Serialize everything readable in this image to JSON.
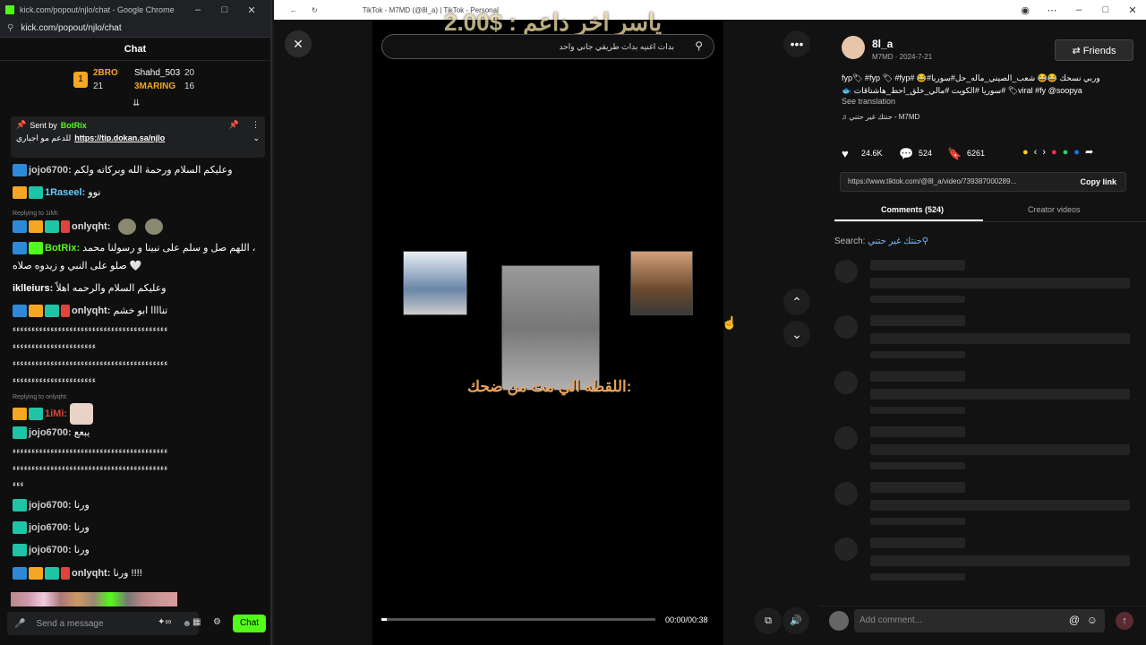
{
  "kick": {
    "window_title": "kick.com/popout/njlo/chat - Google Chrome",
    "url": "kick.com/popout/njlo/chat",
    "chat_header": "Chat",
    "leaders": [
      {
        "rank": "1",
        "name": "2BRO",
        "count": "21"
      },
      {
        "name": "Shahd_503",
        "count": "20"
      },
      {
        "name": "3MARING",
        "count": "16"
      }
    ],
    "pinned": {
      "sent_by": "Sent by",
      "bot": "BotRix",
      "link": "https://tip.dokan.sa/njlo",
      "text": "للدعم مو اجباري"
    },
    "messages": [
      {
        "user": "jojo6700:",
        "text": "وعليكم السلام ورحمة الله وبركاته ولكم"
      },
      {
        "user": "1Raseel:",
        "text": "نوو"
      },
      {
        "reply": "Replying to 1iMi:"
      },
      {
        "user": "onlyqht:",
        "text": ""
      },
      {
        "user": "BotRix:",
        "text": "اللهم صل و سلم على نبينا و رسولنا محمد ،"
      },
      {
        "text": "صلو على النبي و زيدوه صلاه 🤍"
      },
      {
        "user": "iklleiurs:",
        "text": "وعليكم السلام والرحمه اهلاً"
      },
      {
        "user": "onlyqht:",
        "text": "تناااا ابو خشم"
      },
      {
        "text": "ءءءءءءءءءءءءءءءءءءءءءءءءءءءءءءءءءءءءءءءءء"
      },
      {
        "text": "ءءءءءءءءءءءءءءءءءءءءءء"
      },
      {
        "text": "ءءءءءءءءءءءءءءءءءءءءءءءءءءءءءءءءءءءءءءءءء"
      },
      {
        "text": "ءءءءءءءءءءءءءءءءءءءءءء"
      },
      {
        "reply": "Replying to onlyqht:"
      },
      {
        "user": "1iMi:",
        "text": ""
      },
      {
        "user": "jojo6700:",
        "text": "يبعع"
      },
      {
        "text": "ءءءءءءءءءءءءءءءءءءءءءءءءءءءءءءءءءءءءءءءءء"
      },
      {
        "text": "ءءءءءءءءءءءءءءءءءءءءءءءءءءءءءءءءءءءءءءءءء"
      },
      {
        "text": "ءءء"
      },
      {
        "user": "jojo6700:",
        "text": "ورنا"
      },
      {
        "user": "jojo6700:",
        "text": "ورنا"
      },
      {
        "user": "jojo6700:",
        "text": "ورنا"
      },
      {
        "user": "onlyqht:",
        "text": "ورنا !!!!"
      }
    ],
    "input_placeholder": "Send a message",
    "chat_button": "Chat"
  },
  "tiktok": {
    "window_title": "TikTok - M7MD (@8l_a) | TikTok - Personal",
    "overlay_top": "ياسر  اخر داعم : $2.00",
    "search_text": "بدات اغنيه بدات طريقي جاني واحد",
    "caption": "اللقطه الي مت من ضحك:",
    "time": "00:00/00:38",
    "author": {
      "name": "8l_a",
      "sub": "M7MD · 2024-7-21"
    },
    "friends_button": "Friends",
    "description": "وربي نسحك 😂😂 شعب_الصيني_ماله_حل#سوريا#😂 #fyp🏷 #fyp 🏷 #fyp🏷viral #fy @soopya #سوريا #الكويت #مالي_خلق_احط_هاشتاقات 🐟",
    "see_translation": "See translation",
    "sound": "♫ حنتك غير حتني - M7MD",
    "stats": {
      "likes": "24.6K",
      "comments": "524",
      "saves": "6261"
    },
    "link": "https://www.tiktok.com/@8l_a/video/739387000289...",
    "copy_link": "Copy link",
    "tabs": [
      "Comments (524)",
      "Creator videos"
    ],
    "search_label": "Search:",
    "search_term": "حنتك غير حتني",
    "add_comment": "Add comment..."
  }
}
